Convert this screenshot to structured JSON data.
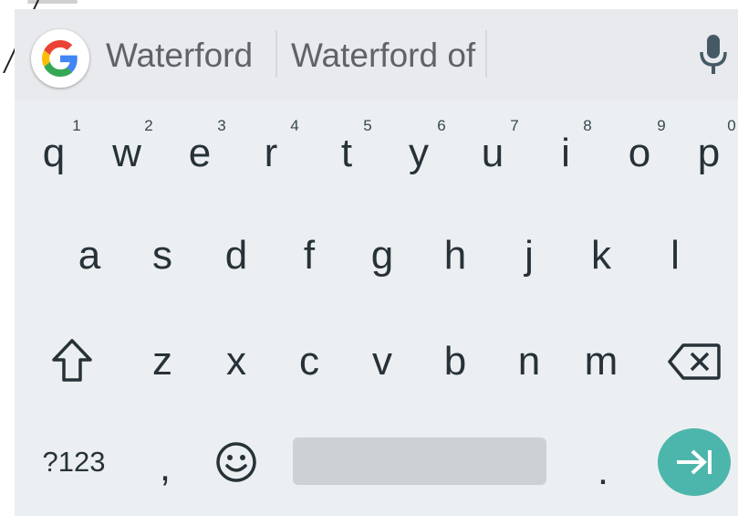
{
  "suggestions": [
    "Waterford",
    "Waterford of"
  ],
  "icons": {
    "google": "google-g-icon",
    "mic": "microphone-icon",
    "shift": "shift-icon",
    "backspace": "backspace-icon",
    "emoji": "emoji-icon",
    "enter": "enter-arrow-icon"
  },
  "colors": {
    "keyboard_bg": "#eceff1",
    "suggestion_bar_bg": "#e8eaed",
    "key_text": "#263238",
    "enter_bg": "#4db6ac",
    "spacebar": "#ccd1d4"
  },
  "rows": {
    "row1": [
      "q",
      "w",
      "e",
      "r",
      "t",
      "y",
      "u",
      "i",
      "o",
      "p"
    ],
    "row1_hints": [
      "1",
      "2",
      "3",
      "4",
      "5",
      "6",
      "7",
      "8",
      "9",
      "0"
    ],
    "row2": [
      "a",
      "s",
      "d",
      "f",
      "g",
      "h",
      "j",
      "k",
      "l"
    ],
    "row3": [
      "z",
      "x",
      "c",
      "v",
      "b",
      "n",
      "m"
    ]
  },
  "bottom": {
    "symbols": "?123",
    "comma": ",",
    "period": "."
  }
}
